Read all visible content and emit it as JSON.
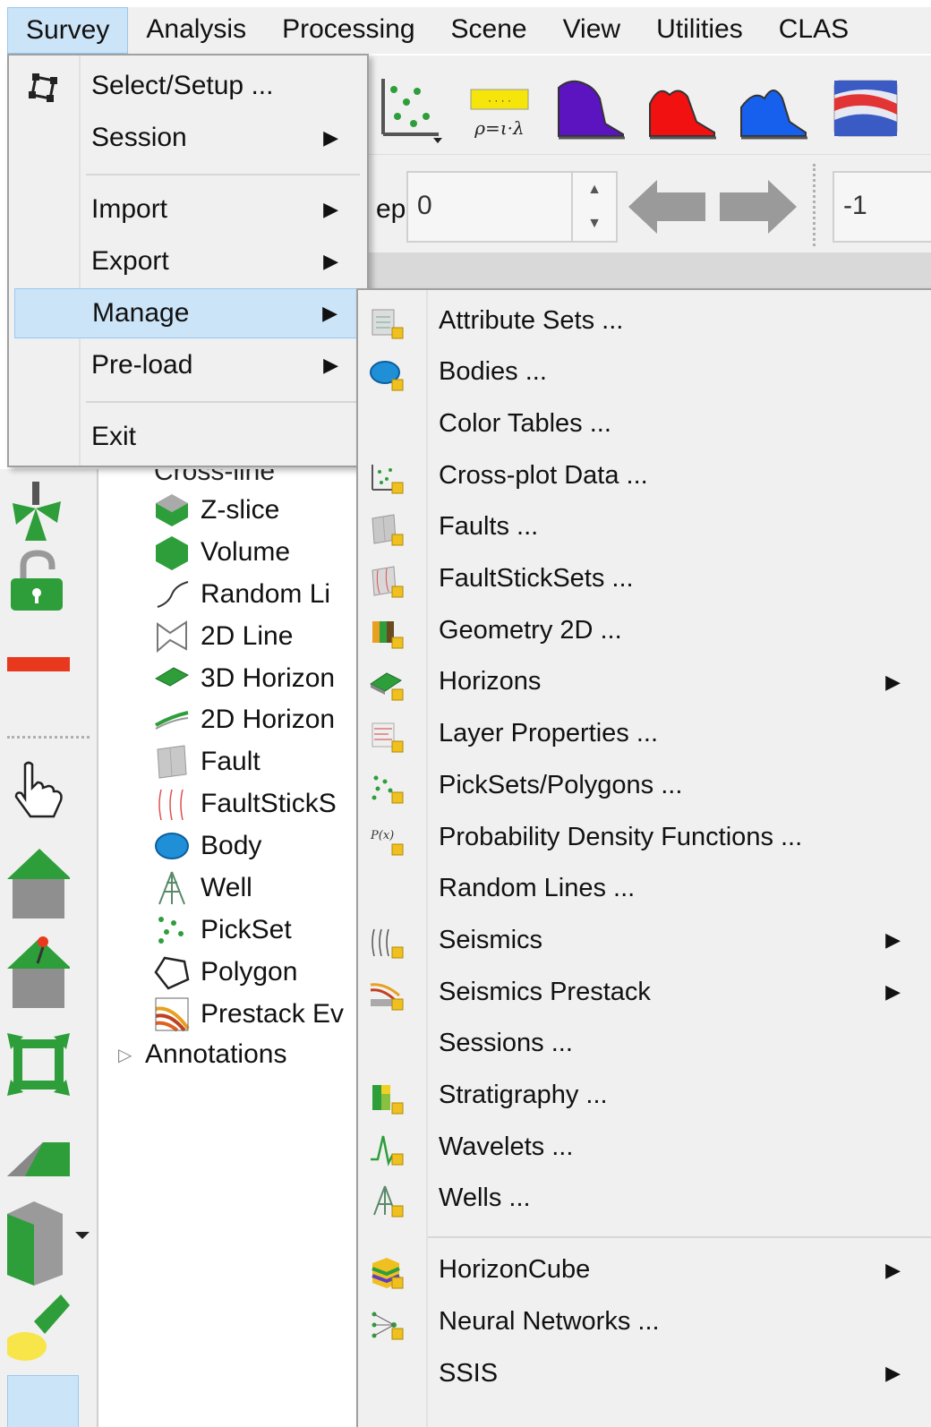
{
  "menubar": {
    "items": [
      "Survey",
      "Analysis",
      "Processing",
      "Scene",
      "View",
      "Utilities",
      "CLAS"
    ]
  },
  "toolbar": {
    "step_label": "ep",
    "step_value": "0",
    "right_field_value": "-1",
    "rho_formula": "ρ=ι·λ"
  },
  "survey_menu": {
    "items": [
      {
        "label": "Select/Setup ...",
        "submenu": false
      },
      {
        "label": "Session",
        "submenu": true
      },
      {
        "label": "Import",
        "submenu": true
      },
      {
        "label": "Export",
        "submenu": true
      },
      {
        "label": "Manage",
        "submenu": true,
        "highlighted": true
      },
      {
        "label": "Pre-load",
        "submenu": true
      },
      {
        "label": "Exit",
        "submenu": false
      }
    ]
  },
  "manage_menu": {
    "items": [
      {
        "label": "Attribute Sets ...",
        "icon": "attribute-sets-icon"
      },
      {
        "label": "Bodies ...",
        "icon": "bodies-icon"
      },
      {
        "label": "Color Tables ...",
        "icon": ""
      },
      {
        "label": "Cross-plot Data ...",
        "icon": "crossplot-icon"
      },
      {
        "label": "Faults ...",
        "icon": "faults-icon"
      },
      {
        "label": "FaultStickSets ...",
        "icon": "faultsticksets-icon"
      },
      {
        "label": "Geometry 2D ...",
        "icon": "geometry2d-icon"
      },
      {
        "label": "Horizons",
        "icon": "horizons-icon",
        "submenu": true
      },
      {
        "label": "Layer Properties ...",
        "icon": "layer-properties-icon"
      },
      {
        "label": "PickSets/Polygons ...",
        "icon": "picksets-icon"
      },
      {
        "label": "Probability Density Functions ...",
        "icon": "pdf-icon",
        "icon_text": "P(x)"
      },
      {
        "label": "Random Lines ...",
        "icon": ""
      },
      {
        "label": "Seismics",
        "icon": "seismics-icon",
        "submenu": true
      },
      {
        "label": "Seismics Prestack",
        "icon": "seismics-prestack-icon",
        "submenu": true
      },
      {
        "label": "Sessions ...",
        "icon": ""
      },
      {
        "label": "Stratigraphy ...",
        "icon": "stratigraphy-icon"
      },
      {
        "label": "Wavelets ...",
        "icon": "wavelets-icon"
      },
      {
        "label": "Wells ...",
        "icon": "wells-icon"
      },
      {
        "label": "HorizonCube",
        "icon": "horizoncube-icon",
        "submenu": true
      },
      {
        "label": "Neural Networks ...",
        "icon": "neural-networks-icon"
      },
      {
        "label": "SSIS",
        "icon": "",
        "submenu": true
      }
    ]
  },
  "tree": {
    "partial_top": "Cross-line",
    "items": [
      "Z-slice",
      "Volume",
      "Random Li",
      "2D Line",
      "3D Horizon",
      "2D Horizon",
      "Fault",
      "FaultStickS",
      "Body",
      "Well",
      "PickSet",
      "Polygon",
      "Prestack Ev"
    ],
    "annotations": "Annotations"
  },
  "colors": {
    "menu_bg": "#f0f0f0",
    "highlight_bg": "#cce4f7",
    "highlight_border": "#99c9ef",
    "accent_green": "#2e9e3a"
  }
}
